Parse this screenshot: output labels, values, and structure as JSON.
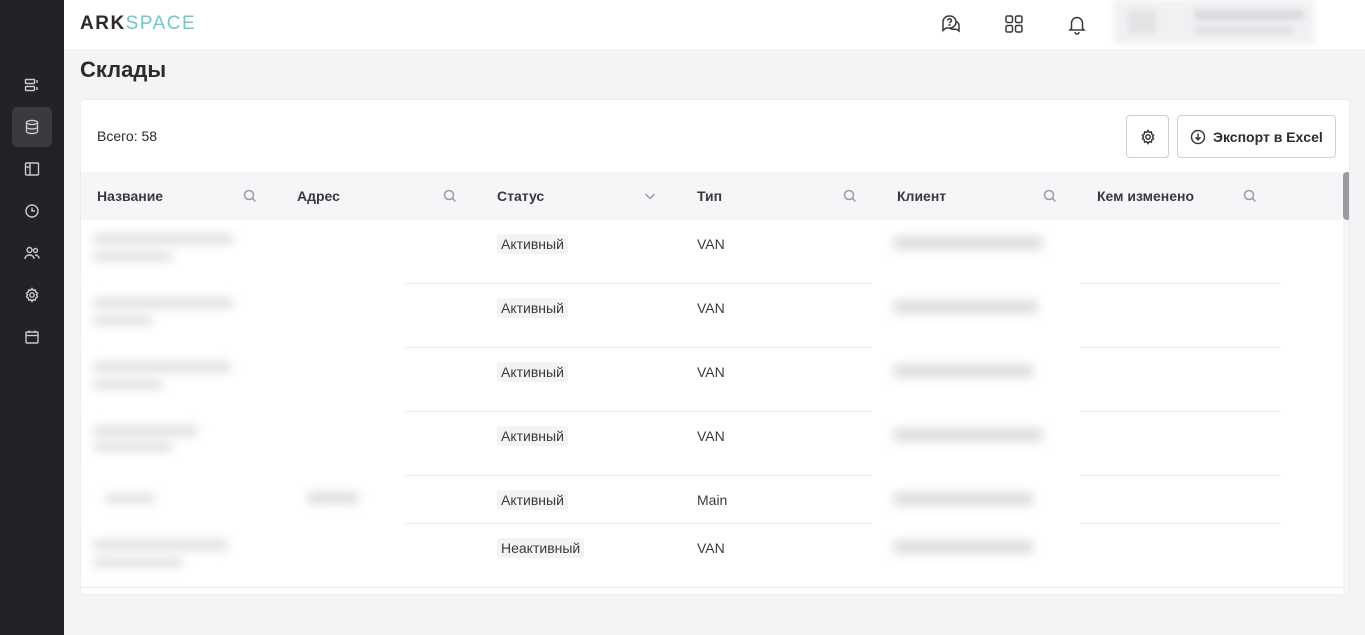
{
  "app": {
    "logo_part1": "ARK",
    "logo_part2": "SPACE"
  },
  "colors": {
    "sidebar_bg": "#222326",
    "accent": "#6cc9cd"
  },
  "sidebar": {
    "items": [
      {
        "icon": "list-icon",
        "active": false
      },
      {
        "icon": "database-icon",
        "active": true
      },
      {
        "icon": "layout-icon",
        "active": false
      },
      {
        "icon": "clock-icon",
        "active": false
      },
      {
        "icon": "users-icon",
        "active": false
      },
      {
        "icon": "gear-icon",
        "active": false
      },
      {
        "icon": "calendar-icon",
        "active": false
      }
    ]
  },
  "topbar": {
    "icons": [
      "chat-help-icon",
      "apps-grid-icon",
      "bell-icon"
    ]
  },
  "page": {
    "title": "Склады",
    "total_label": "Всего: 58",
    "export_label": "Экспорт в Excel"
  },
  "table": {
    "columns": [
      {
        "label": "Название",
        "icon": "search-icon"
      },
      {
        "label": "Адрес",
        "icon": "search-icon"
      },
      {
        "label": "Статус",
        "icon": "chevron-down-icon"
      },
      {
        "label": "Тип",
        "icon": "search-icon"
      },
      {
        "label": "Клиент",
        "icon": "search-icon"
      },
      {
        "label": "Кем изменено",
        "icon": "search-icon"
      }
    ],
    "rows": [
      {
        "status": "Активный",
        "type": "VAN"
      },
      {
        "status": "Активный",
        "type": "VAN"
      },
      {
        "status": "Активный",
        "type": "VAN"
      },
      {
        "status": "Активный",
        "type": "VAN"
      },
      {
        "status": "Активный",
        "type": "Main"
      },
      {
        "status": "Неактивный",
        "type": "VAN"
      }
    ]
  }
}
